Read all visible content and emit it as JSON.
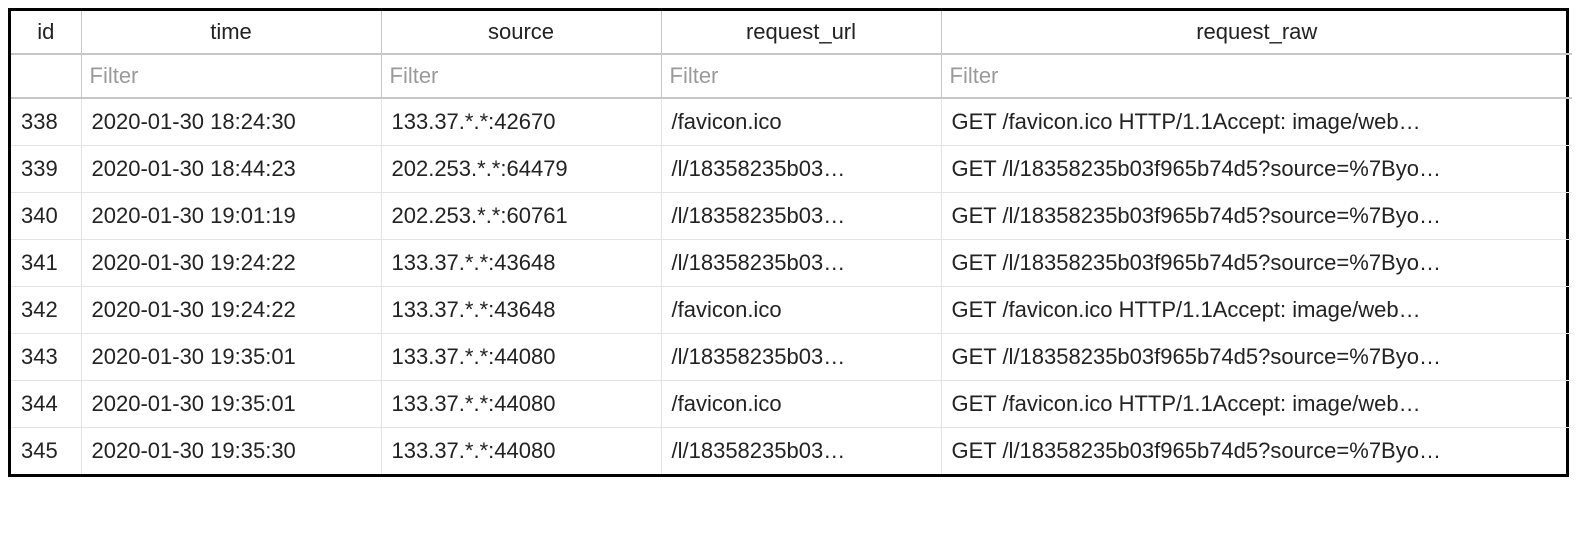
{
  "columns": {
    "id": "id",
    "time": "time",
    "source": "source",
    "request_url": "request_url",
    "request_raw": "request_raw"
  },
  "filter_placeholder": "Filter",
  "rows": [
    {
      "id": "338",
      "time": "2020-01-30 18:24:30",
      "source": "133.37.*.*:42670",
      "request_url": "/favicon.ico",
      "request_raw": "GET /favicon.ico HTTP/1.1Accept: image/web…"
    },
    {
      "id": "339",
      "time": "2020-01-30 18:44:23",
      "source": "202.253.*.*:64479",
      "request_url": "/l/18358235b03…",
      "request_raw": "GET /l/18358235b03f965b74d5?source=%7Byo…"
    },
    {
      "id": "340",
      "time": "2020-01-30 19:01:19",
      "source": "202.253.*.*:60761",
      "request_url": "/l/18358235b03…",
      "request_raw": "GET /l/18358235b03f965b74d5?source=%7Byo…"
    },
    {
      "id": "341",
      "time": "2020-01-30 19:24:22",
      "source": "133.37.*.*:43648",
      "request_url": "/l/18358235b03…",
      "request_raw": "GET /l/18358235b03f965b74d5?source=%7Byo…"
    },
    {
      "id": "342",
      "time": "2020-01-30 19:24:22",
      "source": "133.37.*.*:43648",
      "request_url": "/favicon.ico",
      "request_raw": "GET /favicon.ico HTTP/1.1Accept: image/web…"
    },
    {
      "id": "343",
      "time": "2020-01-30 19:35:01",
      "source": "133.37.*.*:44080",
      "request_url": "/l/18358235b03…",
      "request_raw": "GET /l/18358235b03f965b74d5?source=%7Byo…"
    },
    {
      "id": "344",
      "time": "2020-01-30 19:35:01",
      "source": "133.37.*.*:44080",
      "request_url": "/favicon.ico",
      "request_raw": "GET /favicon.ico HTTP/1.1Accept: image/web…"
    },
    {
      "id": "345",
      "time": "2020-01-30 19:35:30",
      "source": "133.37.*.*:44080",
      "request_url": "/l/18358235b03…",
      "request_raw": "GET /l/18358235b03f965b74d5?source=%7Byo…"
    }
  ]
}
